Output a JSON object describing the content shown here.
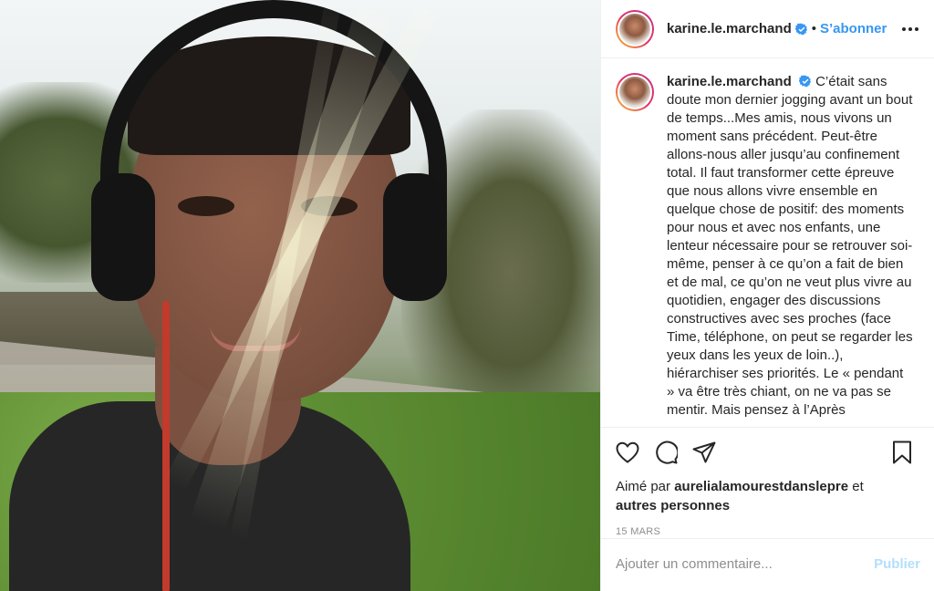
{
  "post": {
    "author": {
      "username": "karine.le.marchand",
      "verified": true
    },
    "header": {
      "separator": "•",
      "follow_label": "S’abonner"
    },
    "caption": "C’était sans doute mon dernier jogging avant un bout de temps...Mes amis, nous vivons un moment sans précédent. Peut-être allons-nous aller jusqu’au confinement total. Il faut transformer cette épreuve que nous allons vivre ensemble en quelque chose de positif: des moments pour nous et avec nos enfants, une lenteur nécessaire pour se retrouver soi-même, penser à ce qu’on a fait de bien et de mal, ce qu’on ne veut plus vivre au quotidien, engager des discussions constructives avec ses proches (face Time, téléphone, on peut se regarder les yeux dans les yeux de loin..), hiérarchiser ses priorités. Le « pendant » va être très chiant, on ne va pas se mentir. Mais pensez à l’Après",
    "likes": {
      "prefix": "Aimé par",
      "user": "aurelialamourestdanslepre",
      "connector": "et",
      "others": "autres personnes"
    },
    "date": "15 MARS",
    "comment": {
      "placeholder": "Ajouter un commentaire...",
      "publish_label": "Publier"
    }
  },
  "icons": {
    "like": "heart-icon",
    "comment": "comment-icon",
    "share": "share-icon",
    "save": "bookmark-icon",
    "more": "more-options-icon",
    "verified": "verified-badge-icon"
  },
  "colors": {
    "link_blue": "#3897f0",
    "publish_disabled": "#b2dffc",
    "muted": "#8e8e8e"
  }
}
